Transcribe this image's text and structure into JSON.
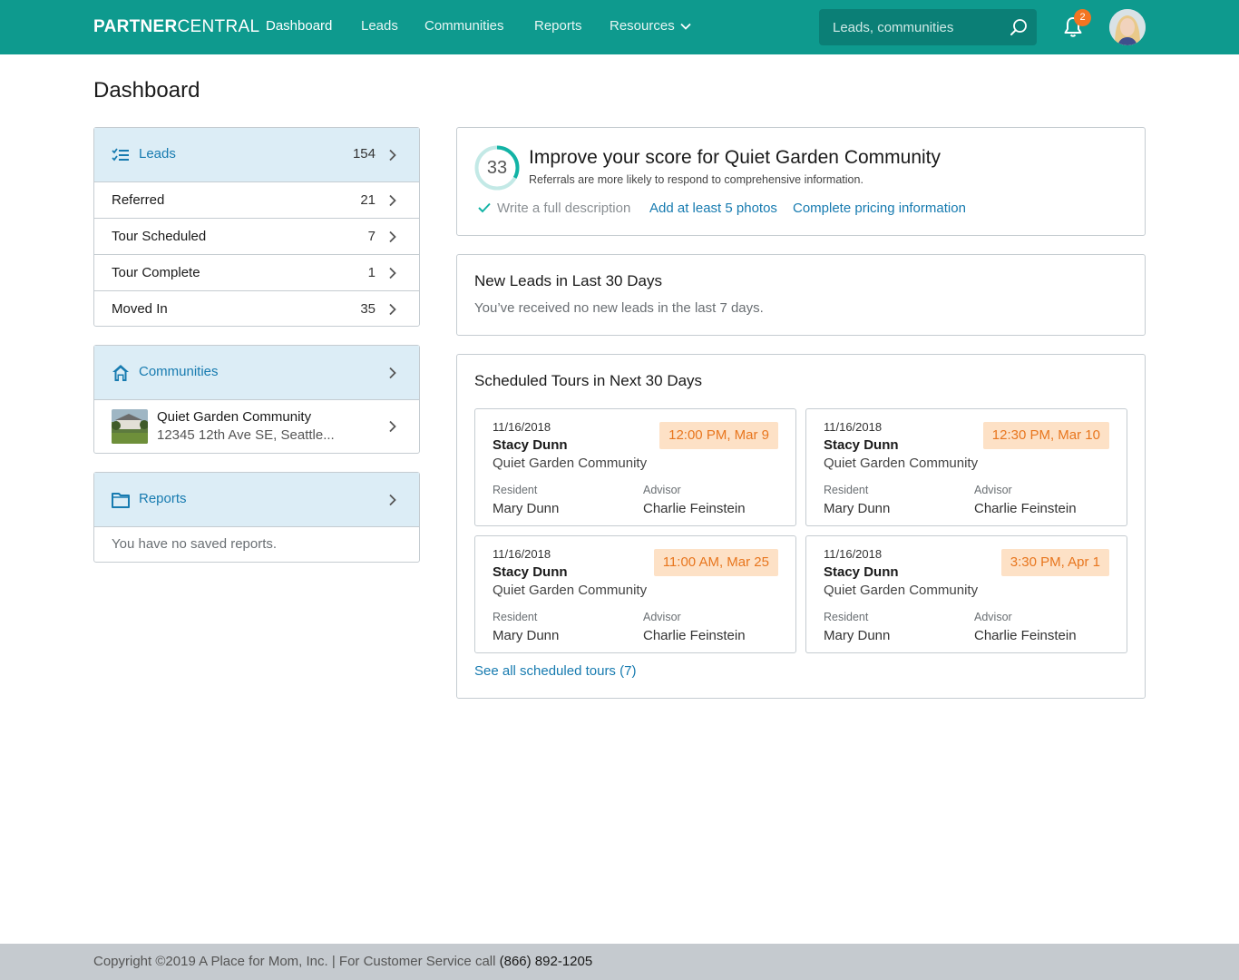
{
  "brand": {
    "bold": "PARTNER",
    "light": "CENTRAL"
  },
  "nav": {
    "dashboard": "Dashboard",
    "leads": "Leads",
    "communities": "Communities",
    "reports": "Reports",
    "resources": "Resources"
  },
  "search": {
    "placeholder": "Leads, communities"
  },
  "notifications": {
    "count": "2"
  },
  "page": {
    "title": "Dashboard"
  },
  "leads_panel": {
    "label": "Leads",
    "count": "154",
    "rows": [
      {
        "label": "Referred",
        "count": "21"
      },
      {
        "label": "Tour Scheduled",
        "count": "7"
      },
      {
        "label": "Tour Complete",
        "count": "1"
      },
      {
        "label": "Moved In",
        "count": "35"
      }
    ]
  },
  "communities_panel": {
    "label": "Communities",
    "item": {
      "name": "Quiet Garden Community",
      "address": "12345 12th Ave SE, Seattle..."
    }
  },
  "reports_panel": {
    "label": "Reports",
    "empty": "You have no saved reports."
  },
  "score_card": {
    "score": "33",
    "score_fraction": 0.33,
    "title": "Improve your score for Quiet Garden Community",
    "subtitle": "Referrals are more likely to respond to comprehensive information.",
    "done_item": "Write a full description",
    "link1": "Add at least 5 photos",
    "link2": "Complete pricing information"
  },
  "new_leads_card": {
    "title": "New Leads in Last 30 Days",
    "message": "You’ve received no new leads in the last 7 days."
  },
  "tours_card": {
    "title": "Scheduled Tours in Next 30 Days",
    "resident_label": "Resident",
    "advisor_label": "Advisor",
    "tours": [
      {
        "date": "11/16/2018",
        "name": "Stacy Dunn",
        "community": "Quiet Garden Community",
        "time": "12:00 PM, Mar 9",
        "resident": "Mary Dunn",
        "advisor": "Charlie Feinstein"
      },
      {
        "date": "11/16/2018",
        "name": "Stacy Dunn",
        "community": "Quiet Garden Community",
        "time": "12:30 PM, Mar 10",
        "resident": "Mary Dunn",
        "advisor": "Charlie Feinstein"
      },
      {
        "date": "11/16/2018",
        "name": "Stacy Dunn",
        "community": "Quiet Garden Community",
        "time": "11:00 AM, Mar 25",
        "resident": "Mary Dunn",
        "advisor": "Charlie Feinstein"
      },
      {
        "date": "11/16/2018",
        "name": "Stacy Dunn",
        "community": "Quiet Garden Community",
        "time": "3:30 PM, Apr 1",
        "resident": "Mary Dunn",
        "advisor": "Charlie Feinstein"
      }
    ],
    "see_all": "See all scheduled tours (7)"
  },
  "footer": {
    "text": "Copyright ©2019 A Place for Mom, Inc. | For Customer Service call ",
    "phone": "(866) 892-1205"
  },
  "colors": {
    "topbar": "#0e9a8e",
    "link": "#177bb0",
    "panel_header": "#dcedf6",
    "time_badge_bg": "#fde1c6",
    "time_badge_text": "#e8761e",
    "notification_badge": "#f27521"
  }
}
